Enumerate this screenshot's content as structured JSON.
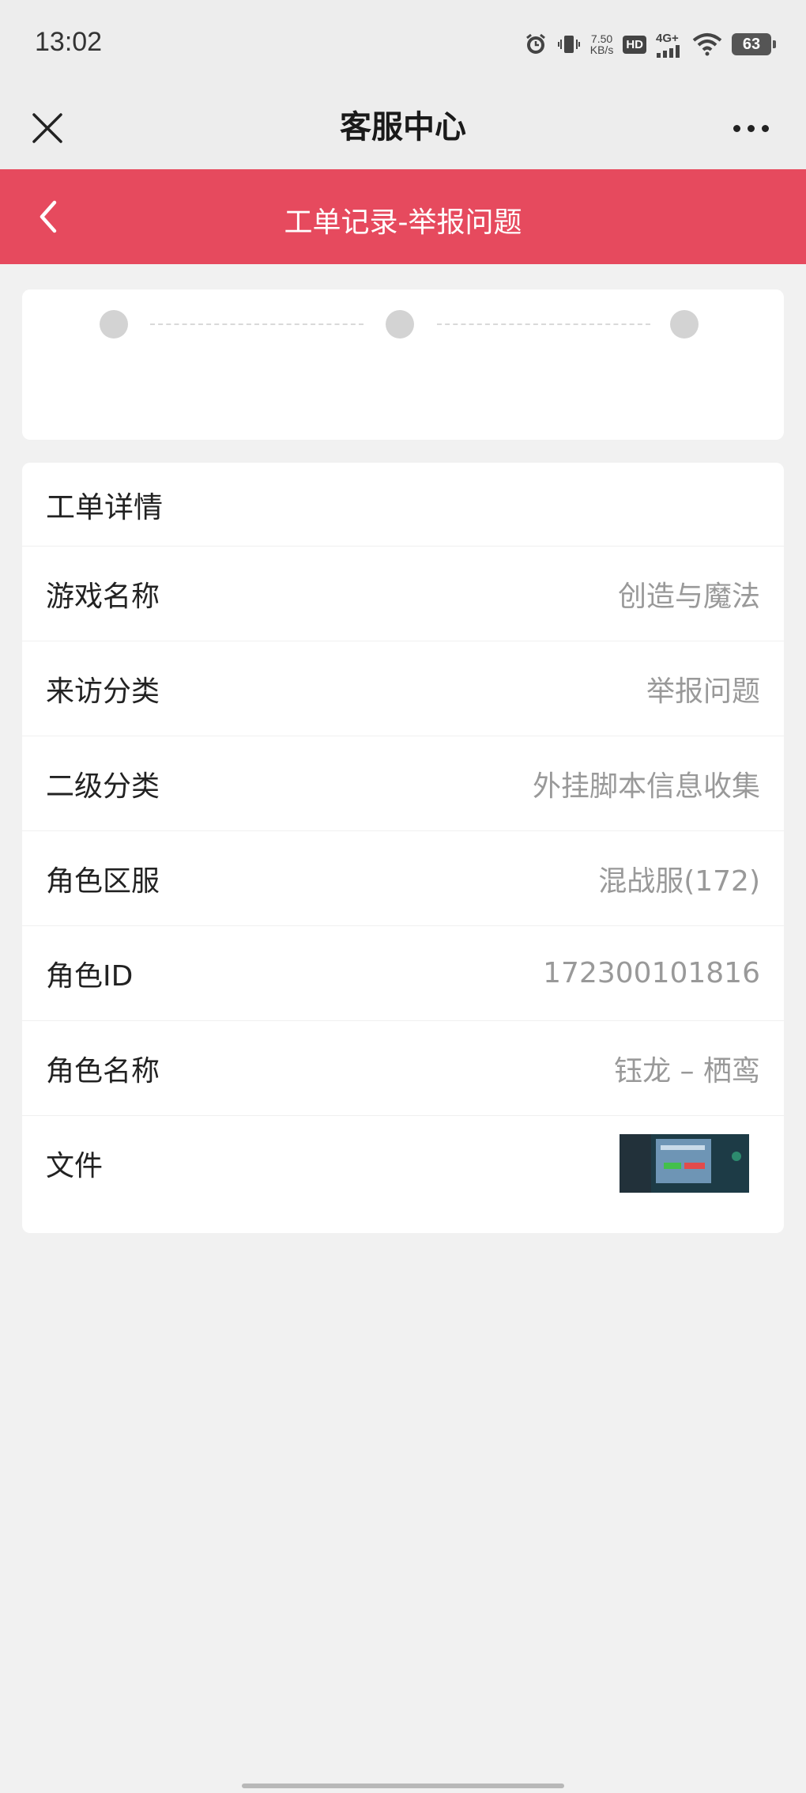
{
  "status_bar": {
    "time": "13:02",
    "net_speed_value": "7.50",
    "net_speed_unit": "KB/s",
    "hd_badge": "HD",
    "network_type": "4G+",
    "battery_level": "63",
    "icons": [
      "alarm-icon",
      "vibrate-icon",
      "signal-icon",
      "wifi-icon",
      "battery-icon"
    ]
  },
  "title_bar": {
    "title": "客服中心",
    "close_icon": "close-icon",
    "more_icon": "more-icon"
  },
  "sub_header": {
    "title": "工单记录-举报问题",
    "back_icon": "chevron-left-icon",
    "color": "#e64a5e"
  },
  "progress": {
    "steps": 3
  },
  "detail": {
    "header": "工单详情",
    "rows": [
      {
        "label": "游戏名称",
        "value": "创造与魔法"
      },
      {
        "label": "来访分类",
        "value": "举报问题"
      },
      {
        "label": "二级分类",
        "value": "外挂脚本信息收集"
      },
      {
        "label": "角色区服",
        "value": "混战服(172)"
      },
      {
        "label": "角色ID",
        "value": "172300101816"
      },
      {
        "label": "角色名称",
        "value": "钰龙 – 栖鸾"
      },
      {
        "label": "文件",
        "value": ""
      }
    ]
  }
}
